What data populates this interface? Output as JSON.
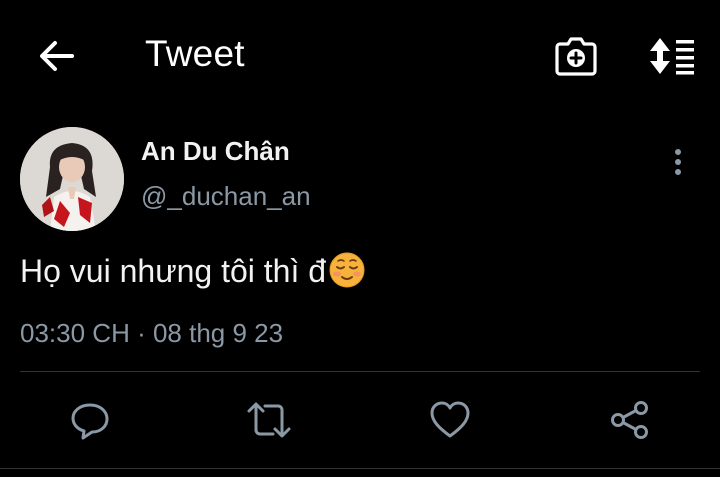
{
  "header": {
    "title": "Tweet",
    "icons": {
      "back": "arrow-left-icon",
      "camera": "camera-add-icon",
      "sort": "sort-list-icon"
    }
  },
  "author": {
    "name": "An Du Chân",
    "handle": "@_duchan_an",
    "avatar": "profile-photo"
  },
  "tweet": {
    "text": "Họ vui nhưng tôi thì đ",
    "emoji": "smiling-face-icon",
    "time": "03:30 CH",
    "separator": " · ",
    "date": "08 thg 9 23"
  },
  "actions": [
    "reply-icon",
    "retweet-icon",
    "like-icon",
    "share-icon"
  ],
  "colors": {
    "background": "#000000",
    "text": "#f2f2f2",
    "secondary": "#8b98a5",
    "divider": "#2f3336"
  }
}
